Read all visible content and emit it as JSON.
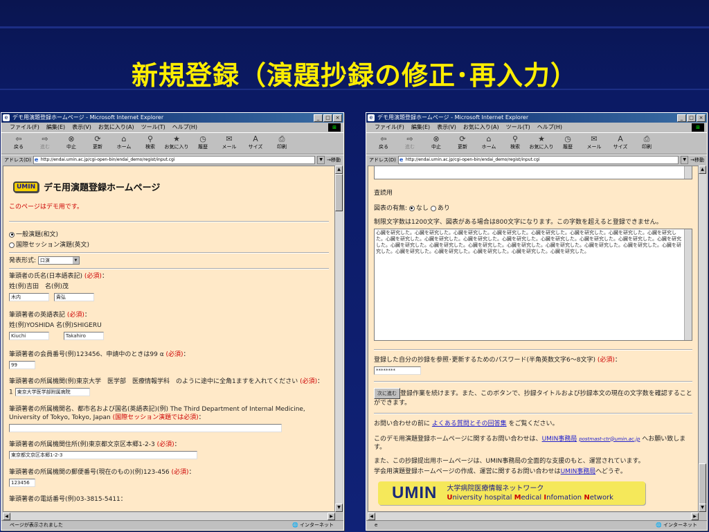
{
  "slide": {
    "title": "新規登録（演題抄録の修正･再入力）"
  },
  "browser": {
    "title": "デモ用演題登録ホームページ - Microsoft Internet Explorer",
    "menu": [
      "ファイル(F)",
      "編集(E)",
      "表示(V)",
      "お気に入り(A)",
      "ツール(T)",
      "ヘルプ(H)"
    ],
    "toolbar": [
      {
        "icon": "back-arrow",
        "label": "戻る"
      },
      {
        "icon": "forward-arrow",
        "label": "進む"
      },
      {
        "icon": "stop-x",
        "label": "中止"
      },
      {
        "icon": "refresh",
        "label": "更新"
      },
      {
        "icon": "home",
        "label": "ホーム"
      },
      {
        "icon": "search",
        "label": "検索"
      },
      {
        "icon": "favorites",
        "label": "お気に入り"
      },
      {
        "icon": "history",
        "label": "履歴"
      },
      {
        "icon": "mail",
        "label": "メール"
      },
      {
        "icon": "size",
        "label": "サイズ"
      },
      {
        "icon": "print",
        "label": "印刷"
      }
    ],
    "address_label": "アドレス(D)",
    "url": "http://endai.umin.ac.jp/cgi-open-bin/endai_demo/regist/input.cgi",
    "go_label": "移動",
    "zone": "インターネット"
  },
  "left": {
    "status": "ページが表示されました",
    "umin_badge": "UMIN",
    "home_title": "デモ用演題登録ホームページ",
    "demo_notice": "このページはデモ用です。",
    "radio1": "一般演題(和文)",
    "radio2": "国際セッション演題(英文)",
    "format_label": "発表形式:",
    "format_value": "口演",
    "name_jp_label": "筆頭者の氏名(日本語表記)",
    "required": "(必須)",
    "colon": "：",
    "name_jp_example": "姓(例)吉田　名(例)茂",
    "name_jp_last": "木内",
    "name_jp_first": "貴弘",
    "name_en_label": "筆頭著者の英語表記",
    "name_en_example": "姓(例)YOSHIDA 名(例)SHIGERU",
    "name_en_last": "Kiuchi",
    "name_en_first": "Takahiro",
    "member_label": "筆頭著者の会員番号(例)123456、申請中のときは99 α",
    "member_value": "99",
    "inst_label": "筆頭著者の所属機関(例)東京大学　医学部　医療情報学科　のように途中に全角1ますを入れてください",
    "inst_prefix": "1",
    "inst_value": "東京大学医学部附属病院",
    "inst_en_label": "筆頭著者の所属機関名、都市名および国名(英語表記)(例) The Third Department of Internal Medicine, University of Tokyo, Tokyo, Japan",
    "inst_en_req": "(国際セッション演題では必須)",
    "addr_label": "筆頭著者の所属機関住所(例)東京都文京区本郷1-2-3",
    "addr_value": "東京都文京区本郷1-2-3",
    "zip_label": "筆頭著者の所属機関の郵便番号(現在のもの)(例)123-456",
    "zip_value": "123456",
    "tel_label": "筆頭著者の電話番号(例)03-3815-5411："
  },
  "right": {
    "status": "",
    "review_label": "査読用",
    "fig_label": "図表の有無:",
    "fig_none": "なし",
    "fig_yes": "あり",
    "limit_text": "制限文字数は1200文字、図表がある場合は800文字になります。この字数を超えると登録できません。",
    "abstract_text": "心臓を研究した。心臓を研究した。心臓を研究した。心臓を研究した。心臓を研究した。心臓を研究した。心臓を研究した。心臓を研究した。心臓を研究した。心臓を研究した。心臓を研究した。心臓を研究した。心臓を研究した。心臓を研究した。心臓を研究した。心臓を研究した。心臓を研究した。心臓を研究した。心臓を研究した。心臓を研究した。心臓を研究した。心臓を研究した。心臓を研究した。心臓を研究した。心臓を研究した。心臓を研究した。心臓を研究した。心臓を研究した。心臓を研究した。",
    "password_label": "登録した自分の抄録を参照･更新するためのパスワード(半角英数文字6～8文字)",
    "required": "(必須)",
    "colon": "：",
    "password_value": "********",
    "next_button": "次に進む",
    "next_text": "登録作業を続けます。また、このボタンで、抄録タイトルおよび抄録本文の現在の文字数を確認することができます。",
    "inquiry_pre": "お問い合わせの前に",
    "faq_link": "よくある質問とその回答集",
    "inquiry_post": "をご覧ください。",
    "contact_pre": "このデモ用演題登録ホームページに関するお問い合わせは、",
    "office_link": "UMIN事務局",
    "email": "postmast-ctr@umin.ac.jp",
    "contact_post": "へお願い致します。",
    "support_1": "また、この抄録提出用ホームページは、UMIN事務局の全面的な支援のもと、運営されています。",
    "support_2_pre": "学会用演題登録ホームページの作成、運営に関するお問い合わせは",
    "support_2_link": "UMIN事務局",
    "support_2_post": "へどうぞ。",
    "footer_logo": "UMIN",
    "footer_jp": "大学病院医療情報ネットワーク",
    "footer_en_u": "U",
    "footer_en_1": "niversity hospital ",
    "footer_en_m": "M",
    "footer_en_2": "edical ",
    "footer_en_i": "I",
    "footer_en_3": "nfomation ",
    "footer_en_n": "N",
    "footer_en_4": "etwork"
  }
}
